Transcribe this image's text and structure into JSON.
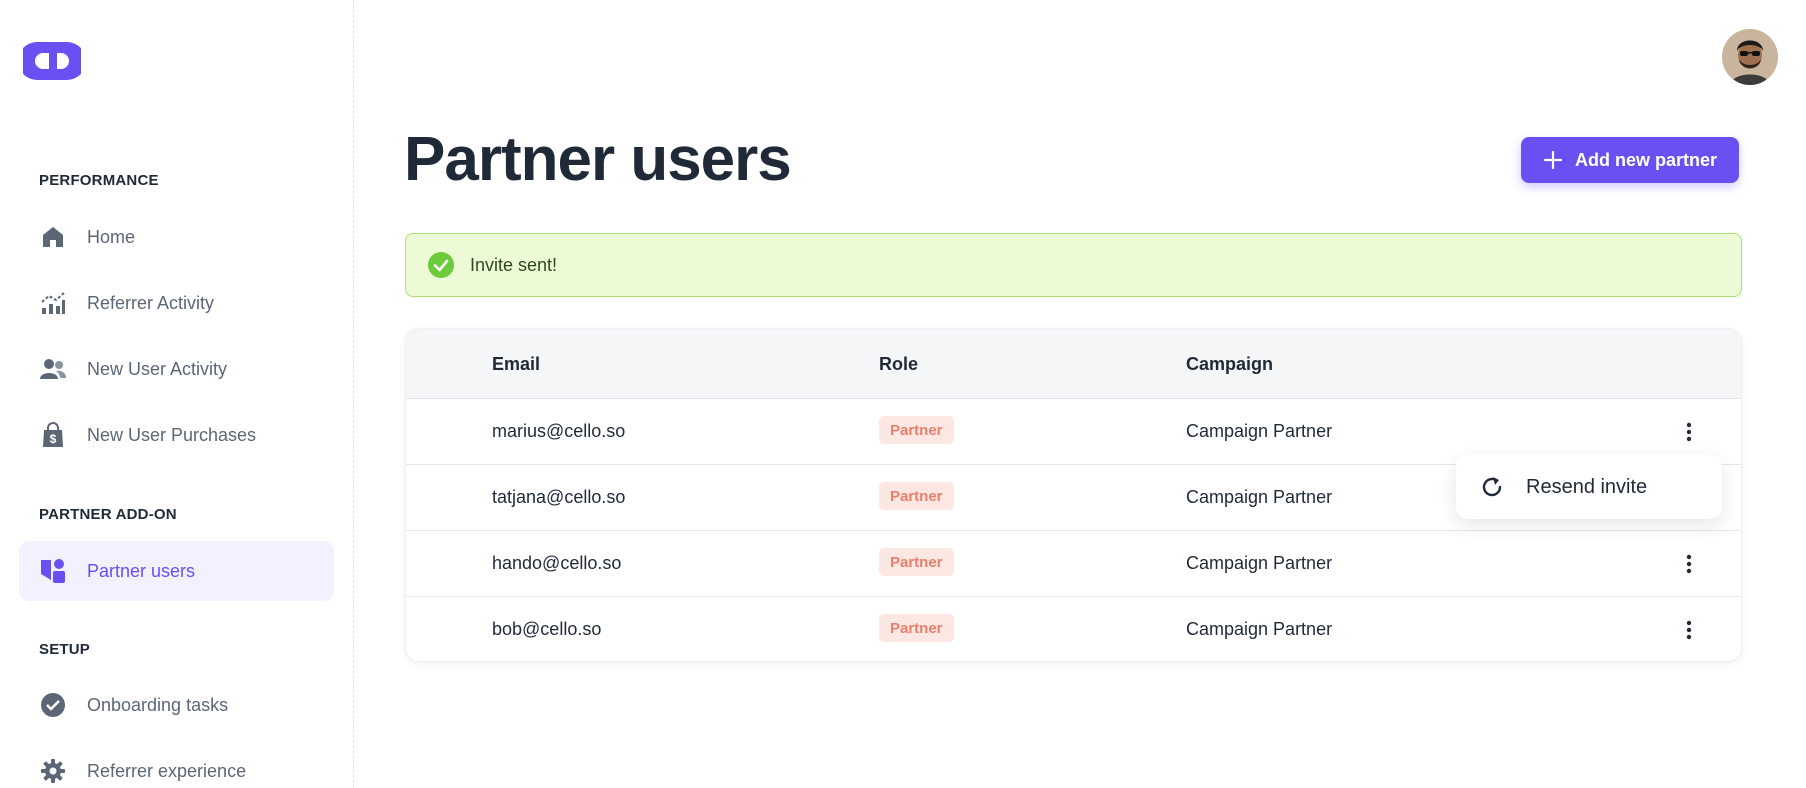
{
  "sidebar": {
    "sections": [
      {
        "title": "PERFORMANCE"
      },
      {
        "title": "PARTNER ADD-ON"
      },
      {
        "title": "SETUP"
      }
    ],
    "items": [
      {
        "label": "Home",
        "icon": "home-icon"
      },
      {
        "label": "Referrer Activity",
        "icon": "chart-icon"
      },
      {
        "label": "New User Activity",
        "icon": "users-icon"
      },
      {
        "label": "New User Purchases",
        "icon": "shopping-bag-icon"
      },
      {
        "label": "Partner users",
        "icon": "partner-icon",
        "active": true
      },
      {
        "label": "Onboarding tasks",
        "icon": "check-circle-icon"
      },
      {
        "label": "Referrer experience",
        "icon": "gear-icon"
      }
    ]
  },
  "header": {
    "title": "Partner users",
    "add_button_label": "Add new partner"
  },
  "alert": {
    "message": "Invite sent!"
  },
  "table": {
    "columns": [
      "Email",
      "Role",
      "Campaign"
    ],
    "rows": [
      {
        "email": "marius@cello.so",
        "role": "Partner",
        "campaign": "Campaign Partner"
      },
      {
        "email": "tatjana@cello.so",
        "role": "Partner",
        "campaign": "Campaign Partner"
      },
      {
        "email": "hando@cello.so",
        "role": "Partner",
        "campaign": "Campaign Partner"
      },
      {
        "email": "bob@cello.so",
        "role": "Partner",
        "campaign": "Campaign Partner"
      }
    ]
  },
  "popover": {
    "label": "Resend invite"
  },
  "colors": {
    "accent": "#6a4ff2",
    "success_bg": "#ecfad6",
    "badge_bg": "#fde7e2",
    "badge_text": "#e8806d"
  }
}
